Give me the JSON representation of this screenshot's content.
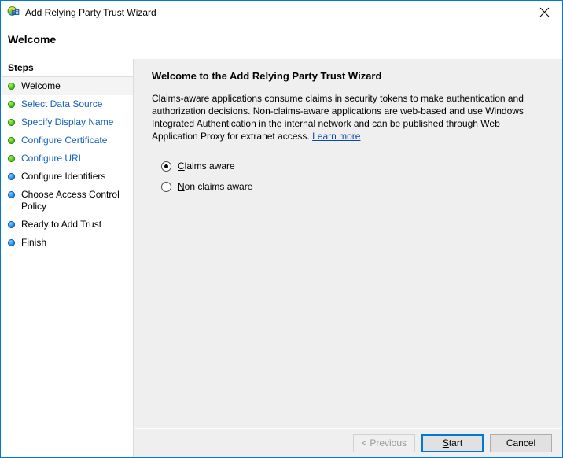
{
  "window": {
    "title": "Add Relying Party Trust Wizard",
    "icon": "federation-globe-icon",
    "close_label": "✕",
    "border_color": "#0078d7"
  },
  "header": {
    "page_title": "Welcome"
  },
  "sidebar": {
    "header_label": "Steps",
    "items": [
      {
        "label": "Welcome",
        "state": "current",
        "bullet": "done"
      },
      {
        "label": "Select Data Source",
        "state": "done",
        "bullet": "done"
      },
      {
        "label": "Specify Display Name",
        "state": "done",
        "bullet": "done"
      },
      {
        "label": "Configure Certificate",
        "state": "done",
        "bullet": "done"
      },
      {
        "label": "Configure URL",
        "state": "done",
        "bullet": "done"
      },
      {
        "label": "Configure Identifiers",
        "state": "pending",
        "bullet": "pending"
      },
      {
        "label": "Choose Access Control Policy",
        "state": "pending",
        "bullet": "pending"
      },
      {
        "label": "Ready to Add Trust",
        "state": "pending",
        "bullet": "pending"
      },
      {
        "label": "Finish",
        "state": "pending",
        "bullet": "pending"
      }
    ]
  },
  "main": {
    "heading": "Welcome to the Add Relying Party Trust Wizard",
    "paragraph_text": "Claims-aware applications consume claims in security tokens to make authentication and authorization decisions. Non-claims-aware applications are web-based and use Windows Integrated Authentication in the internal network and can be published through Web Application Proxy for extranet access. ",
    "learn_more_label": "Learn more",
    "radios": [
      {
        "label_prefix": "",
        "access_key": "C",
        "label_rest": "laims aware",
        "selected": true
      },
      {
        "label_prefix": "",
        "access_key": "N",
        "label_rest": "on claims aware",
        "selected": false
      }
    ]
  },
  "footer": {
    "previous": {
      "label": "< Previous",
      "disabled": true
    },
    "start": {
      "access_key": "S",
      "label_rest": "tart",
      "default": true
    },
    "cancel": {
      "label": "Cancel",
      "disabled": false
    }
  }
}
